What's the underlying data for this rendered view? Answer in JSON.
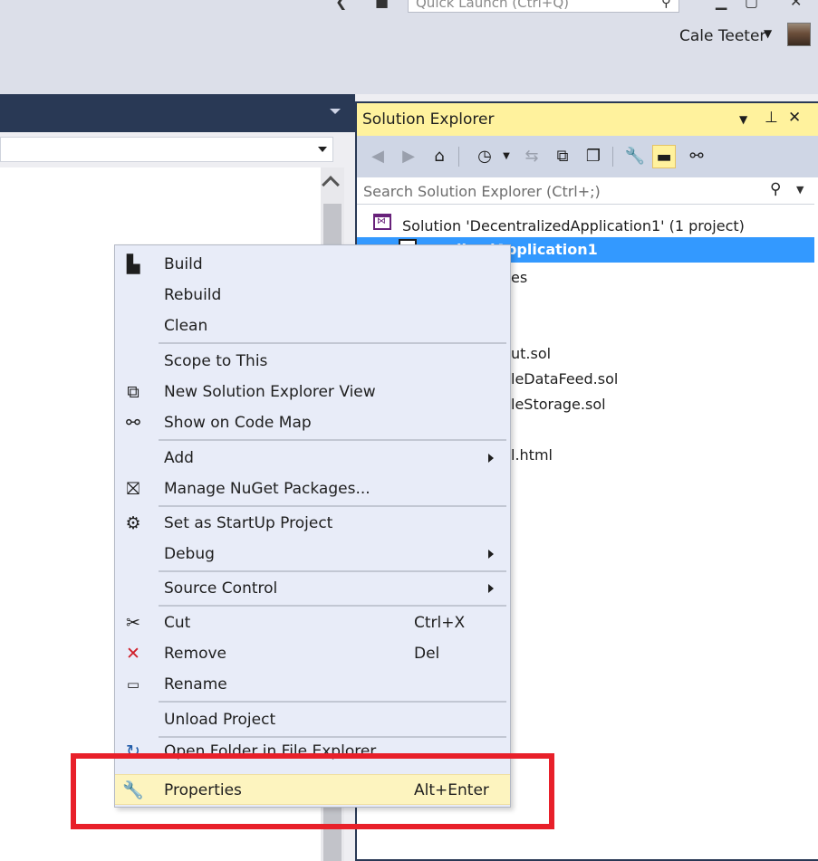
{
  "titlebar": {
    "quick_launch_placeholder": "Quick Launch (Ctrl+Q)",
    "user_name": "Cale Teeter"
  },
  "solution_explorer": {
    "title": "Solution Explorer",
    "search_placeholder": "Search Solution Explorer (Ctrl+;)",
    "tree": [
      {
        "label": "Solution 'DecentralizedApplication1' (1 project)"
      },
      {
        "label": "DecentralizedApplication1",
        "selected": true,
        "visible_text": "lizedApplication1"
      },
      {
        "label": "es"
      },
      {
        "label": "ut.sol"
      },
      {
        "label": "leDataFeed.sol"
      },
      {
        "label": "leStorage.sol"
      },
      {
        "label": "l.html"
      }
    ]
  },
  "context_menu": {
    "items": [
      {
        "label": "Build",
        "icon": "build-icon"
      },
      {
        "label": "Rebuild"
      },
      {
        "label": "Clean"
      },
      {
        "label": "Scope to This"
      },
      {
        "label": "New Solution Explorer View",
        "icon": "new-view-icon"
      },
      {
        "label": "Show on Code Map",
        "icon": "code-map-icon"
      },
      {
        "label": "Add",
        "submenu": true
      },
      {
        "label": "Manage NuGet Packages...",
        "icon": "nuget-icon"
      },
      {
        "label": "Set as StartUp Project",
        "icon": "gear-icon"
      },
      {
        "label": "Debug",
        "submenu": true
      },
      {
        "label": "Source Control",
        "submenu": true
      },
      {
        "label": "Cut",
        "shortcut": "Ctrl+X",
        "icon": "scissors-icon"
      },
      {
        "label": "Remove",
        "shortcut": "Del",
        "icon": "remove-x-icon"
      },
      {
        "label": "Rename",
        "icon": "rename-icon"
      },
      {
        "label": "Unload Project"
      },
      {
        "label": "Open Folder in File Explorer",
        "icon": "open-folder-icon"
      },
      {
        "label": "Properties",
        "shortcut": "Alt+Enter",
        "icon": "wrench-icon",
        "highlighted": true
      }
    ]
  },
  "colors": {
    "title_accent": "#fff29d",
    "selection": "#3399ff",
    "annotation": "#e8202a",
    "header_dark": "#293955"
  }
}
